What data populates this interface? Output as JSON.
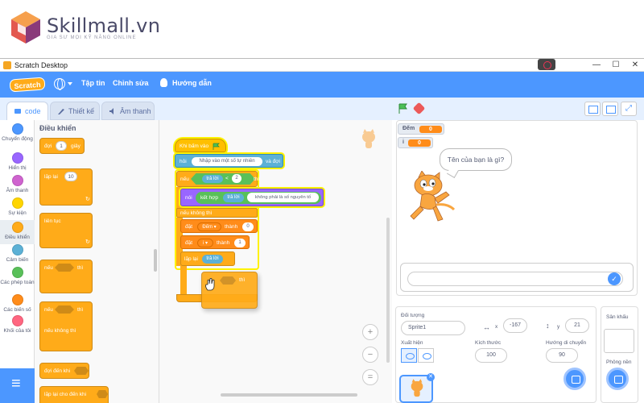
{
  "brand": {
    "name": "Skillmall.vn",
    "tagline": "GIA SƯ MỌI KỸ NĂNG ONLINE"
  },
  "window": {
    "title": "Scratch Desktop",
    "minimize": "—",
    "maximize": "☐",
    "close": "✕"
  },
  "menubar": {
    "logo": "Scratch",
    "file": "Tập tin",
    "edit": "Chỉnh sửa",
    "tutorials": "Hướng dẫn"
  },
  "tabs": {
    "code": "code",
    "costumes": "Thiết kế",
    "sounds": "Âm thanh"
  },
  "categories": [
    {
      "label": "Chuyển động",
      "color": "#4c97ff"
    },
    {
      "label": "Hiển thị",
      "color": "#9966ff"
    },
    {
      "label": "Âm thanh",
      "color": "#cf63cf"
    },
    {
      "label": "Sự kiện",
      "color": "#ffd500"
    },
    {
      "label": "Điều khiển",
      "color": "#ffab19"
    },
    {
      "label": "Cảm biến",
      "color": "#5cb1d6"
    },
    {
      "label": "Các phép toán",
      "color": "#59c059"
    },
    {
      "label": "Các biến số",
      "color": "#ff8c1a"
    },
    {
      "label": "Khối của tôi",
      "color": "#ff6680"
    }
  ],
  "palette": {
    "title": "Điều khiển",
    "wait": "đợi",
    "wait_val": "1",
    "wait_unit": "giây",
    "repeat": "lặp lại",
    "repeat_val": "10",
    "forever": "liên tục",
    "if_then": "nếu",
    "then": "thì",
    "if_else_if": "nếu",
    "if_else_then": "thì",
    "else": "nếu không thì",
    "wait_until": "đợi đến khi",
    "repeat_until": "lặp lại cho đến khi"
  },
  "script": {
    "hat": "Khi bấm vào",
    "ask": "hỏi",
    "ask_text": "Nhập vào một số tự nhiên",
    "ask_wait": "và đợi",
    "if": "nếu",
    "answer1": "trả lời",
    "lt": "<",
    "num": "2",
    "then": "thì",
    "say": "nói",
    "join": "kết hợp",
    "answer2": "trả lời",
    "not_prime": "không phải là số nguyên tố",
    "else": "nếu không thì",
    "set1": "đặt",
    "var1": "Đếm ▾",
    "to1": "thành",
    "val1": "0",
    "set2": "đặt",
    "var2": "i ▾",
    "to2": "thành",
    "val2": "1",
    "repeat": "lặp lại",
    "answer3": "trả lời",
    "drag_then": "thì"
  },
  "stage": {
    "monitor_count_label": "Đếm",
    "monitor_count_val": "0",
    "monitor_i_label": "i",
    "monitor_i_val": "0",
    "bubble": "Tên của bạn là gì?"
  },
  "sprite_info": {
    "sprite_label": "Đối tượng",
    "sprite_name": "Sprite1",
    "x_label": "x",
    "x_val": "-167",
    "y_label": "y",
    "y_val": "21",
    "show_label": "Xuất hiện",
    "size_label": "Kích thước",
    "size_val": "100",
    "direction_label": "Hướng di chuyển",
    "direction_val": "90"
  },
  "stage_pane": {
    "title": "Sân khấu",
    "backdrops": "Phông nền"
  }
}
